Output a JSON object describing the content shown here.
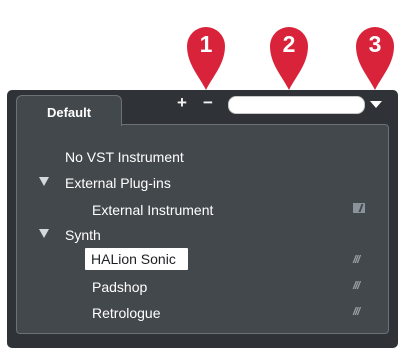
{
  "callouts": [
    "1",
    "2",
    "3"
  ],
  "colors": {
    "callout": "#d9233a",
    "panel": "#2f3337",
    "content": "#43484d"
  },
  "toolbar": {
    "add_label": "+",
    "remove_label": "−",
    "search_value": "",
    "dropdown_icon": "caret-down-icon"
  },
  "tabs": [
    {
      "label": "Default"
    }
  ],
  "tree": {
    "no_vst": "No VST Instrument",
    "external_folder": "External Plug-ins",
    "external_instrument": "External Instrument",
    "synth_folder": "Synth",
    "synth_items": [
      "HALion Sonic",
      "Padshop",
      "Retrologue"
    ],
    "selected": "HALion Sonic",
    "rack_icon_glyph": "///"
  }
}
